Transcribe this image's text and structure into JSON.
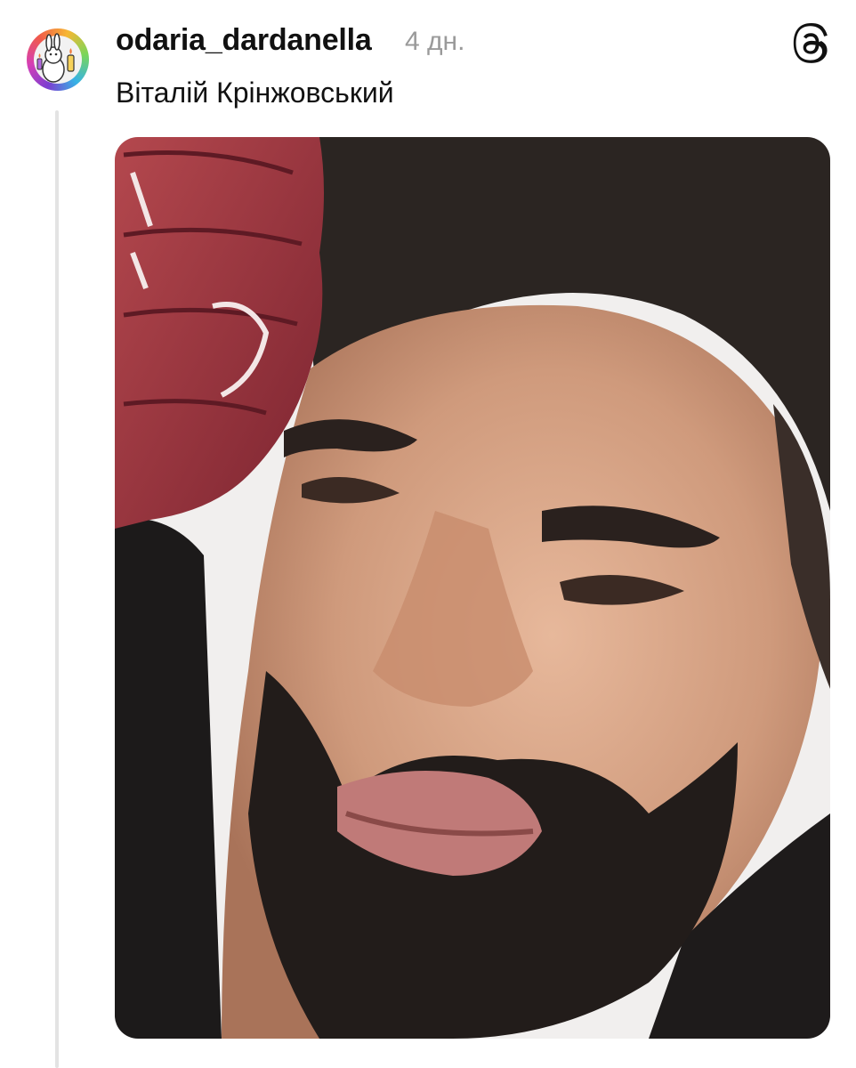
{
  "post": {
    "username": "odaria_dardanella",
    "timestamp": "4 дн.",
    "text": "Віталій Крінжовський",
    "avatar_icon": "bunny-avatar-icon",
    "app_icon": "threads-logo-icon",
    "media": "photo of bearded man squinting with red gloved fist"
  },
  "colors": {
    "text": "#111111",
    "muted": "#9a9a9a",
    "thread_line": "#e3e3e3"
  }
}
